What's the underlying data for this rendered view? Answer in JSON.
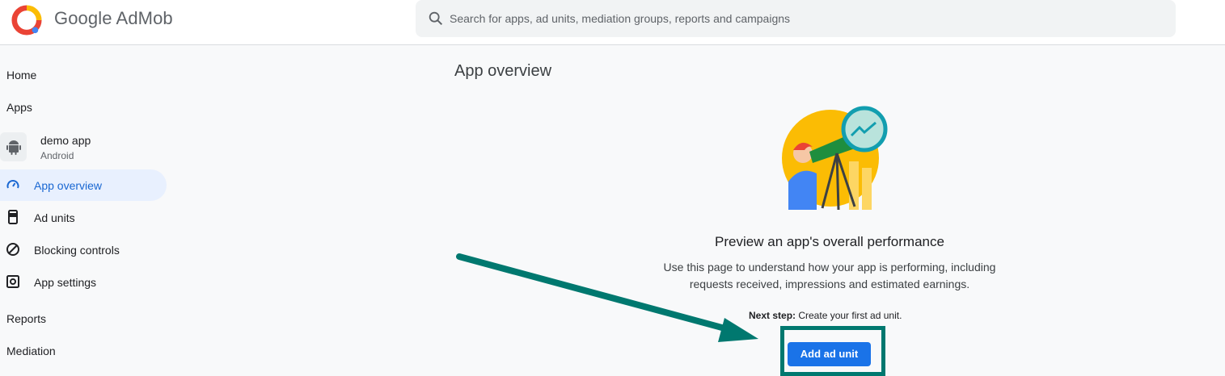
{
  "header": {
    "brand_google": "Google",
    "brand_product": "AdMob",
    "search_placeholder": "Search for apps, ad units, mediation groups, reports and campaigns"
  },
  "sidebar": {
    "home": "Home",
    "apps": "Apps",
    "app": {
      "name": "demo app",
      "platform": "Android"
    },
    "items": [
      {
        "label": "App overview",
        "icon": "speedometer-icon",
        "active": true
      },
      {
        "label": "Ad units",
        "icon": "phone-icon",
        "active": false
      },
      {
        "label": "Blocking controls",
        "icon": "block-icon",
        "active": false
      },
      {
        "label": "App settings",
        "icon": "settings-icon",
        "active": false
      }
    ],
    "reports": "Reports",
    "mediation": "Mediation"
  },
  "main": {
    "title": "App overview",
    "headline": "Preview an app's overall performance",
    "description": "Use this page to understand how your app is performing, including requests received, impressions and estimated earnings.",
    "next_step_label": "Next step:",
    "next_step_text": " Create your first ad unit.",
    "add_button": "Add ad unit"
  },
  "colors": {
    "accent": "#1a73e8",
    "annotation": "#00786f",
    "active_bg": "#e8f0fe"
  }
}
